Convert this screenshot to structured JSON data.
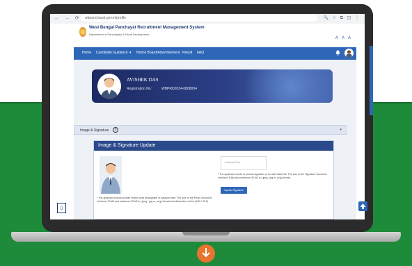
{
  "browser": {
    "url": "wbpanchayat.gov.in/profile",
    "nav_controls": "← → ⟳ ⌂",
    "toolbar_icons": "🔍 ☆ ⧉ ◫ ⋮"
  },
  "header": {
    "title": "West Bengal Panchayat Recruitment Management System",
    "subtitle": "Department of Panchayats & Rural Development",
    "font_controls": "A A A"
  },
  "navbar": {
    "items": [
      "Home",
      "Candidate Guidance",
      "Notice Board/Advertisement",
      "Result",
      "FAQ"
    ],
    "color": "#2f67b8"
  },
  "profile": {
    "name": "AVISHEK DAS",
    "registration_label": "Registration No:",
    "registration_value": "WBPRD2024-0808004"
  },
  "accordion": {
    "label": "Image & Signature",
    "help_glyph": "?"
  },
  "panel": {
    "title": "Image & Signature Update",
    "photo_note": "* The applicant should provide recent clear photograph in passport size. The size of the Photo should be minimum 20 kB and maximum 50 kB in (.jpeg, .jpg or .png) format and dimension not be (100 X 213).",
    "signature_placeholder": "Avishek Das",
    "signature_note": "* The applicant needs to provide signature in for with black ink. The size of the Signature should be minimum 10kb and maximum 30 KB in (.jpeg, .jpg or .png) format.",
    "upload_label": "Upload Signature"
  },
  "colors": {
    "accent": "#2f67b8",
    "background_green": "#1e8b3a",
    "badge_orange": "#e8742d"
  }
}
